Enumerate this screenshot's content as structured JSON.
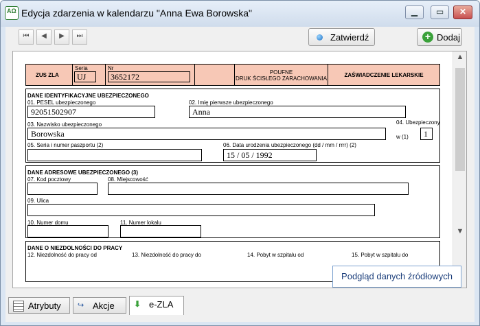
{
  "window": {
    "title": "Edycja zdarzenia w kalendarzu \"Anna Ewa Borowska\"",
    "icon": "calendar-app-icon"
  },
  "toolbar": {
    "confirm_label": "Zatwierdź",
    "add_label": "Dodaj"
  },
  "form": {
    "header": {
      "zus_zla": "ZUS ZLA",
      "seria_label": "Seria",
      "seria_value": "UJ",
      "nr_label": "Nr",
      "nr_value": "3652172",
      "poufne_line1": "POUFNE",
      "poufne_line2": "DRUK ŚCISŁEGO ZARACHOWANIA",
      "zaswiadczenie": "ZAŚWIADCZENIE LEKARSKIE"
    },
    "insured": {
      "section": "DANE IDENTYFIKACYJNE UBEZPIECZONEGO",
      "pesel_label": "01. PESEL ubezpieczonego",
      "pesel_value": "92051502907",
      "first_name_label": "02. Imię pierwsze ubezpieczonego",
      "first_name_value": "Anna",
      "last_name_label": "03. Nazwisko ubezpieczonego",
      "last_name_value": "Borowska",
      "insured_count_label": "04. Ubezpieczony",
      "insured_count_prefix": "w (1)",
      "insured_count_value": "1",
      "passport_label": "05. Seria i numer paszportu (2)",
      "passport_value": "",
      "birthdate_label": "06. Data urodzenia ubezpieczonego (dd / mm / rrrr) (2)",
      "birthdate_value": "15 / 05 / 1992"
    },
    "address": {
      "section": "DANE ADRESOWE UBEZPIECZONEGO (3)",
      "postal_label": "07. Kod pocztowy",
      "city_label": "08. Miejscowość",
      "street_label": "09. Ulica",
      "house_label": "10. Numer domu",
      "flat_label": "11. Numer lokalu"
    },
    "incapacity": {
      "section": "DANE O NIEZDOLNOŚCI DO PRACY",
      "col12": "12. Niezdolność do pracy od",
      "col13": "13. Niezdolność do pracy do",
      "col14": "14. Pobyt w szpitalu od",
      "col15": "15. Pobyt w szpitalu do"
    }
  },
  "source_button": "Podgląd danych źródłowych",
  "tabs": [
    {
      "label": "Atrybuty",
      "icon": "attributes-icon"
    },
    {
      "label": "Akcje",
      "icon": "actions-icon"
    },
    {
      "label": "e-ZLA",
      "icon": "ezla-icon"
    }
  ],
  "colors": {
    "header_fill": "#f7c8b6",
    "accent_blue": "#1a3d7a",
    "add_green": "#3aa13a"
  }
}
